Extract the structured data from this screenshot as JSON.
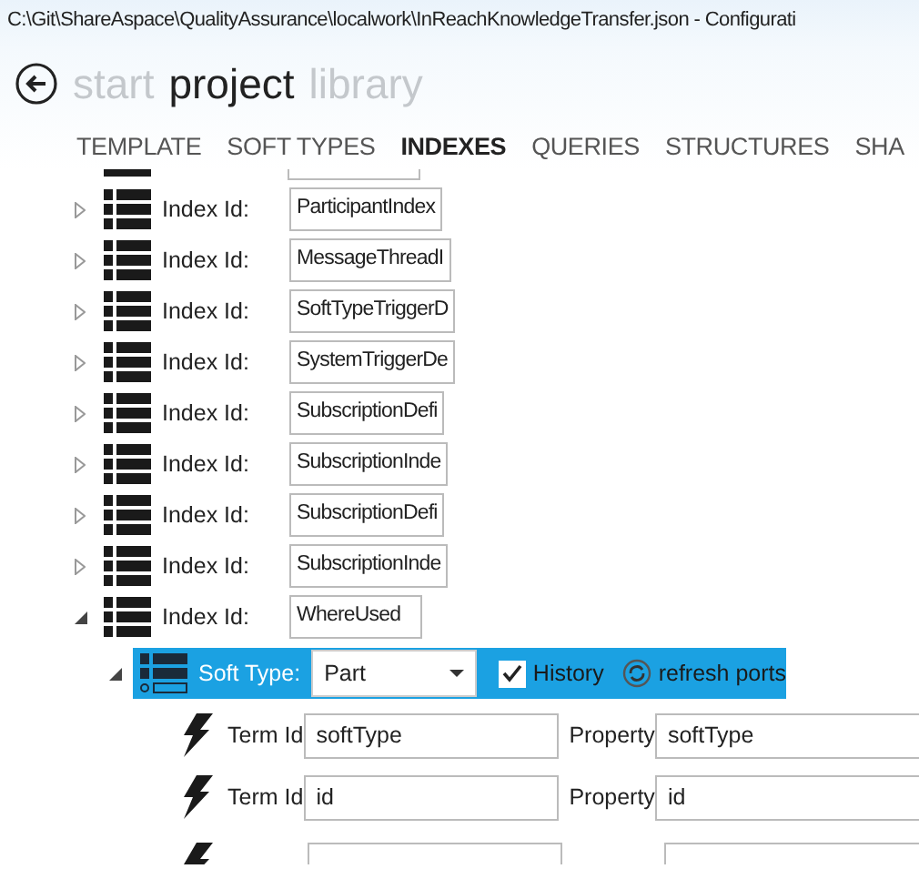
{
  "window": {
    "title": "C:\\Git\\ShareAspace\\QualityAssurance\\localwork\\InReachKnowledgeTransfer.json - Configurati"
  },
  "nav": [
    {
      "label": "start",
      "selected": false
    },
    {
      "label": "project",
      "selected": true
    },
    {
      "label": "library",
      "selected": false
    }
  ],
  "tabs": [
    {
      "label": "TEMPLATE",
      "selected": false
    },
    {
      "label": "SOFT TYPES",
      "selected": false
    },
    {
      "label": "INDEXES",
      "selected": true
    },
    {
      "label": "QUERIES",
      "selected": false
    },
    {
      "label": "STRUCTURES",
      "selected": false
    },
    {
      "label": "SHA",
      "selected": false
    }
  ],
  "indexes": [
    {
      "label": "Index Id:",
      "value": "ParticipantIndex",
      "expanded": false
    },
    {
      "label": "Index Id:",
      "value": "MessageThreadI",
      "expanded": false
    },
    {
      "label": "Index Id:",
      "value": "SoftTypeTriggerD",
      "expanded": false
    },
    {
      "label": "Index Id:",
      "value": "SystemTriggerDe",
      "expanded": false
    },
    {
      "label": "Index Id:",
      "value": "SubscriptionDefi",
      "expanded": false
    },
    {
      "label": "Index Id:",
      "value": "SubscriptionInde",
      "expanded": false
    },
    {
      "label": "Index Id:",
      "value": "SubscriptionDefi",
      "expanded": false
    },
    {
      "label": "Index Id:",
      "value": "SubscriptionInde",
      "expanded": false
    },
    {
      "label": "Index Id:",
      "value": "WhereUsed",
      "expanded": true
    }
  ],
  "soft_type": {
    "label": "Soft Type:",
    "value": "Part",
    "expanded": true,
    "history": {
      "label": "History",
      "checked": true
    },
    "refresh": "refresh ports"
  },
  "terms": [
    {
      "term_label": "Term Id",
      "term_value": "softType",
      "property_label": "Property",
      "property_value": "softType"
    },
    {
      "term_label": "Term Id",
      "term_value": "id",
      "property_label": "Property",
      "property_value": "id"
    }
  ]
}
